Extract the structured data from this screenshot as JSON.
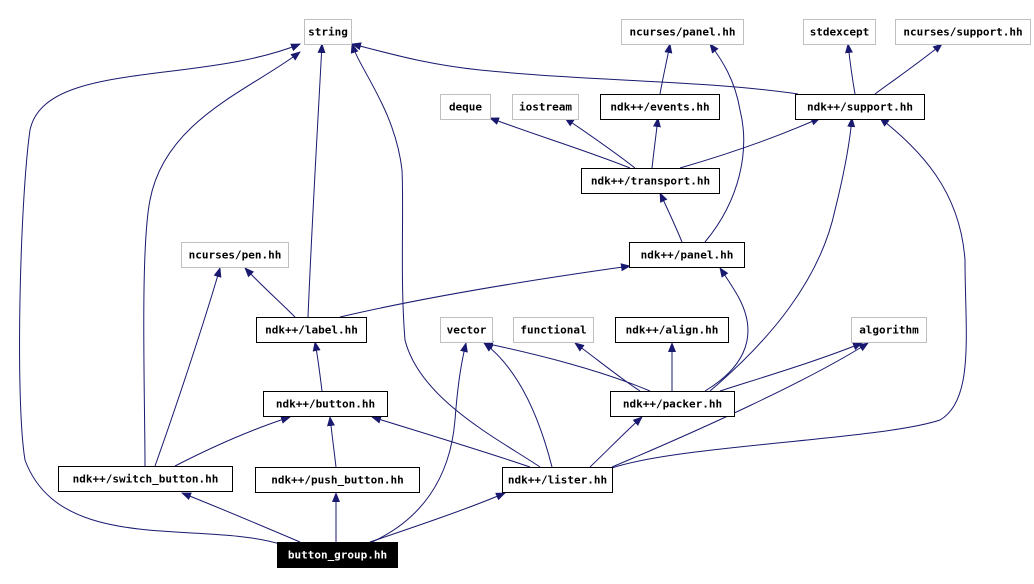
{
  "colors": {
    "edge": "#191970",
    "external_border": "#bfbfbf",
    "internal_border": "#000000",
    "focus_fill": "#000000",
    "focus_text": "#ffffff"
  },
  "nodes": [
    {
      "id": "string",
      "label": "string",
      "kind": "external"
    },
    {
      "id": "ncurses_panel",
      "label": "ncurses/panel.hh",
      "kind": "external"
    },
    {
      "id": "stdexcept",
      "label": "stdexcept",
      "kind": "external"
    },
    {
      "id": "ncurses_support",
      "label": "ncurses/support.hh",
      "kind": "external"
    },
    {
      "id": "deque",
      "label": "deque",
      "kind": "external"
    },
    {
      "id": "iostream",
      "label": "iostream",
      "kind": "external"
    },
    {
      "id": "events",
      "label": "ndk++/events.hh",
      "kind": "internal"
    },
    {
      "id": "support",
      "label": "ndk++/support.hh",
      "kind": "internal"
    },
    {
      "id": "transport",
      "label": "ndk++/transport.hh",
      "kind": "internal"
    },
    {
      "id": "pen",
      "label": "ncurses/pen.hh",
      "kind": "external"
    },
    {
      "id": "panel",
      "label": "ndk++/panel.hh",
      "kind": "internal"
    },
    {
      "id": "label",
      "label": "ndk++/label.hh",
      "kind": "internal"
    },
    {
      "id": "vector",
      "label": "vector",
      "kind": "external"
    },
    {
      "id": "functional",
      "label": "functional",
      "kind": "external"
    },
    {
      "id": "align",
      "label": "ndk++/align.hh",
      "kind": "internal"
    },
    {
      "id": "algorithm",
      "label": "algorithm",
      "kind": "external"
    },
    {
      "id": "button",
      "label": "ndk++/button.hh",
      "kind": "internal"
    },
    {
      "id": "packer",
      "label": "ndk++/packer.hh",
      "kind": "internal"
    },
    {
      "id": "switch_button",
      "label": "ndk++/switch_button.hh",
      "kind": "internal"
    },
    {
      "id": "push_button",
      "label": "ndk++/push_button.hh",
      "kind": "internal"
    },
    {
      "id": "lister",
      "label": "ndk++/lister.hh",
      "kind": "internal"
    },
    {
      "id": "button_group",
      "label": "button_group.hh",
      "kind": "focus"
    }
  ],
  "edges": [
    [
      "button_group",
      "switch_button"
    ],
    [
      "button_group",
      "push_button"
    ],
    [
      "button_group",
      "lister"
    ],
    [
      "button_group",
      "string"
    ],
    [
      "button_group",
      "vector"
    ],
    [
      "switch_button",
      "string"
    ],
    [
      "switch_button",
      "pen"
    ],
    [
      "switch_button",
      "button"
    ],
    [
      "push_button",
      "button"
    ],
    [
      "lister",
      "button"
    ],
    [
      "lister",
      "string"
    ],
    [
      "lister",
      "vector"
    ],
    [
      "lister",
      "packer"
    ],
    [
      "lister",
      "algorithm"
    ],
    [
      "lister",
      "support"
    ],
    [
      "button",
      "label"
    ],
    [
      "label",
      "string"
    ],
    [
      "label",
      "pen"
    ],
    [
      "label",
      "panel"
    ],
    [
      "packer",
      "vector"
    ],
    [
      "packer",
      "functional"
    ],
    [
      "packer",
      "align"
    ],
    [
      "packer",
      "algorithm"
    ],
    [
      "packer",
      "panel"
    ],
    [
      "packer",
      "support"
    ],
    [
      "panel",
      "transport"
    ],
    [
      "panel",
      "ncurses_panel"
    ],
    [
      "transport",
      "deque"
    ],
    [
      "transport",
      "iostream"
    ],
    [
      "transport",
      "events"
    ],
    [
      "transport",
      "support"
    ],
    [
      "events",
      "ncurses_panel"
    ],
    [
      "support",
      "string"
    ],
    [
      "support",
      "stdexcept"
    ],
    [
      "support",
      "ncurses_support"
    ]
  ]
}
